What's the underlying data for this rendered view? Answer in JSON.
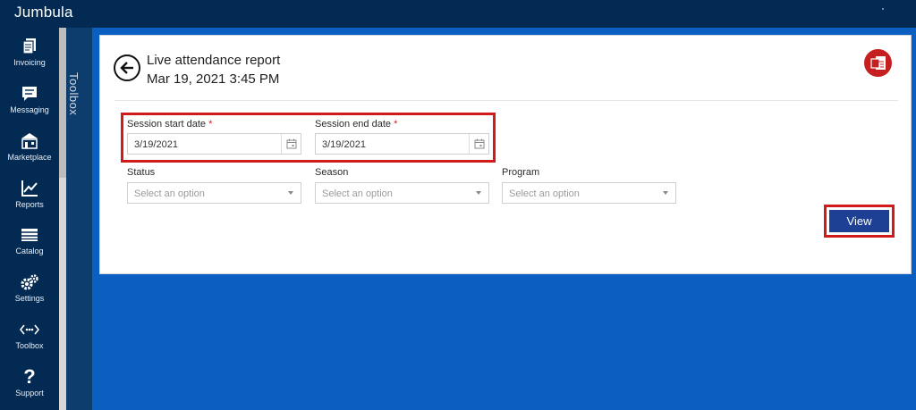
{
  "app": {
    "brand": "Jumbula"
  },
  "nav": {
    "items": [
      {
        "label": "Invoicing",
        "icon": "invoice-icon"
      },
      {
        "label": "Messaging",
        "icon": "message-icon"
      },
      {
        "label": "Marketplace",
        "icon": "marketplace-icon"
      },
      {
        "label": "Reports",
        "icon": "chart-icon"
      },
      {
        "label": "Catalog",
        "icon": "catalog-icon"
      },
      {
        "label": "Settings",
        "icon": "gear-icon"
      },
      {
        "label": "Toolbox",
        "icon": "toolbox-icon"
      },
      {
        "label": "Support",
        "icon": "question-icon"
      }
    ]
  },
  "toolbox": {
    "label": "Toolbox"
  },
  "report": {
    "title": "Live attendance report",
    "datetime": "Mar 19, 2021 3:45 PM",
    "session_start": {
      "label": "Session start date",
      "required": "*",
      "value": "3/19/2021"
    },
    "session_end": {
      "label": "Session end date",
      "required": "*",
      "value": "3/19/2021"
    },
    "status": {
      "label": "Status",
      "placeholder": "Select an option"
    },
    "season": {
      "label": "Season",
      "placeholder": "Select an option"
    },
    "program": {
      "label": "Program",
      "placeholder": "Select an option"
    },
    "view_label": "View"
  },
  "colors": {
    "topbar": "#032a52",
    "background": "#0a5fc0",
    "highlight": "#d11a1a",
    "view_button": "#1d3f94",
    "export_button": "#c51f1f"
  }
}
